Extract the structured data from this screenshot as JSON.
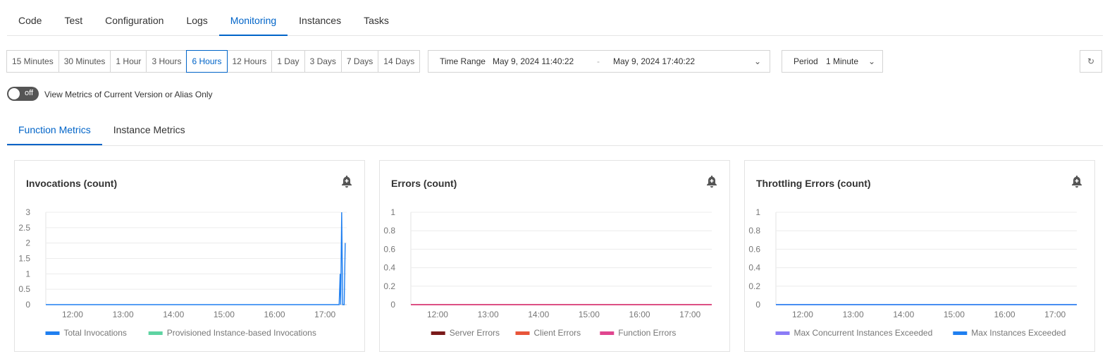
{
  "tabs": [
    "Code",
    "Test",
    "Configuration",
    "Logs",
    "Monitoring",
    "Instances",
    "Tasks"
  ],
  "active_tab": "Monitoring",
  "ranges": [
    "15 Minutes",
    "30 Minutes",
    "1 Hour",
    "3 Hours",
    "6 Hours",
    "12 Hours",
    "1 Day",
    "3 Days",
    "7 Days",
    "14 Days"
  ],
  "active_range": "6 Hours",
  "time_range": {
    "label": "Time Range",
    "start": "May 9, 2024 11:40:22",
    "sep": "-",
    "end": "May 9, 2024 17:40:22"
  },
  "period": {
    "label": "Period",
    "value": "1 Minute"
  },
  "toggle": {
    "state": "off",
    "label": "View Metrics of Current Version or Alias Only"
  },
  "subtabs": [
    "Function Metrics",
    "Instance Metrics"
  ],
  "colors": {
    "accent": "#0064c8"
  },
  "chart_data": [
    {
      "type": "line",
      "title": "Invocations (count)",
      "ylim": [
        0,
        3
      ],
      "yticks": [
        "0",
        "0.5",
        "1",
        "1.5",
        "2",
        "2.5",
        "3"
      ],
      "xticks": [
        "12:00",
        "13:00",
        "14:00",
        "15:00",
        "16:00",
        "17:00"
      ],
      "xrange_hours": [
        11.47,
        17.43
      ],
      "series": [
        {
          "name": "Total Invocations",
          "color": "#1f7ff0",
          "points": [
            [
              11.47,
              0
            ],
            [
              17.28,
              0
            ],
            [
              17.3,
              1
            ],
            [
              17.31,
              0
            ],
            [
              17.33,
              3
            ],
            [
              17.35,
              0
            ],
            [
              17.38,
              0
            ],
            [
              17.4,
              2
            ]
          ]
        },
        {
          "name": "Provisioned Instance-based Invocations",
          "color": "#5ed3a2",
          "points": []
        }
      ]
    },
    {
      "type": "line",
      "title": "Errors (count)",
      "ylim": [
        0,
        1
      ],
      "yticks": [
        "0",
        "0.2",
        "0.4",
        "0.6",
        "0.8",
        "1"
      ],
      "xticks": [
        "12:00",
        "13:00",
        "14:00",
        "15:00",
        "16:00",
        "17:00"
      ],
      "xrange_hours": [
        11.47,
        17.43
      ],
      "series": [
        {
          "name": "Server Errors",
          "color": "#7a1a1a",
          "points": [
            [
              11.47,
              0
            ],
            [
              17.43,
              0
            ]
          ]
        },
        {
          "name": "Client Errors",
          "color": "#e8553a",
          "points": [
            [
              11.47,
              0
            ],
            [
              17.43,
              0
            ]
          ]
        },
        {
          "name": "Function Errors",
          "color": "#e0468f",
          "points": [
            [
              11.47,
              0
            ],
            [
              17.43,
              0
            ]
          ]
        }
      ]
    },
    {
      "type": "line",
      "title": "Throttling Errors (count)",
      "ylim": [
        0,
        1
      ],
      "yticks": [
        "0",
        "0.2",
        "0.4",
        "0.6",
        "0.8",
        "1"
      ],
      "xticks": [
        "12:00",
        "13:00",
        "14:00",
        "15:00",
        "16:00",
        "17:00"
      ],
      "xrange_hours": [
        11.47,
        17.43
      ],
      "series": [
        {
          "name": "Max Concurrent Instances Exceeded",
          "color": "#8b7cf6",
          "points": [
            [
              11.47,
              0
            ],
            [
              17.43,
              0
            ]
          ]
        },
        {
          "name": "Max Instances Exceeded",
          "color": "#1f7ff0",
          "points": [
            [
              11.47,
              0
            ],
            [
              17.43,
              0
            ]
          ]
        }
      ]
    }
  ]
}
